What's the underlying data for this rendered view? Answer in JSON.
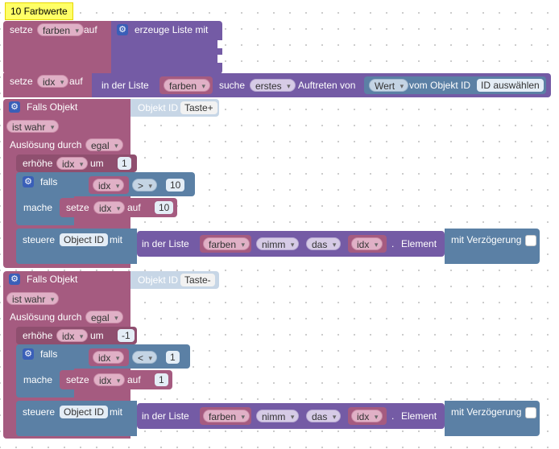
{
  "comment": "10 Farbwerte",
  "block1": {
    "setze": "setze",
    "var": "farben",
    "auf": "auf",
    "list_label": "erzeuge Liste mit"
  },
  "block2": {
    "setze": "setze",
    "var": "idx",
    "auf": "auf",
    "in_der_liste": "in der Liste",
    "list_var": "farben",
    "suche": "suche",
    "mode": "erstes",
    "auftreten": "Auftreten von",
    "prop": "Wert",
    "vom_objekt": "vom Objekt ID",
    "id_btn": "ID auswählen"
  },
  "trigger1": {
    "falls_objekt": "Falls Objekt",
    "objekt_id": "Objekt ID",
    "objekt_value": "Taste+",
    "condition": "ist wahr",
    "ausloesung": "Auslösung durch",
    "ausloesung_value": "egal",
    "erhoehe": "erhöhe",
    "var": "idx",
    "um": "um",
    "um_value": "1",
    "falls": "falls",
    "cmp_var": "idx",
    "op": ">",
    "cmp_value": "10",
    "mache": "mache",
    "setze": "setze",
    "set_var": "idx",
    "auf": "auf",
    "set_value": "10",
    "steuere": "steuere",
    "object_id": "Object ID",
    "mit": "mit",
    "in_der_liste": "in der Liste",
    "list_var": "farben",
    "nimm": "nimm",
    "das": "das",
    "idx_var": "idx",
    "dot": ".",
    "element": "Element",
    "verzoegerung": "mit Verzögerung"
  },
  "trigger2": {
    "falls_objekt": "Falls Objekt",
    "objekt_id": "Objekt ID",
    "objekt_value": "Taste-",
    "condition": "ist wahr",
    "ausloesung": "Auslösung durch",
    "ausloesung_value": "egal",
    "erhoehe": "erhöhe",
    "var": "idx",
    "um": "um",
    "um_value": "-1",
    "falls": "falls",
    "cmp_var": "idx",
    "op": "<",
    "cmp_value": "1",
    "mache": "mache",
    "setze": "setze",
    "set_var": "idx",
    "auf": "auf",
    "set_value": "1",
    "steuere": "steuere",
    "object_id": "Object ID",
    "mit": "mit",
    "in_der_liste": "in der Liste",
    "list_var": "farben",
    "nimm": "nimm",
    "das": "das",
    "idx_var": "idx",
    "dot": ".",
    "element": "Element",
    "verzoegerung": "mit Verzögerung"
  }
}
